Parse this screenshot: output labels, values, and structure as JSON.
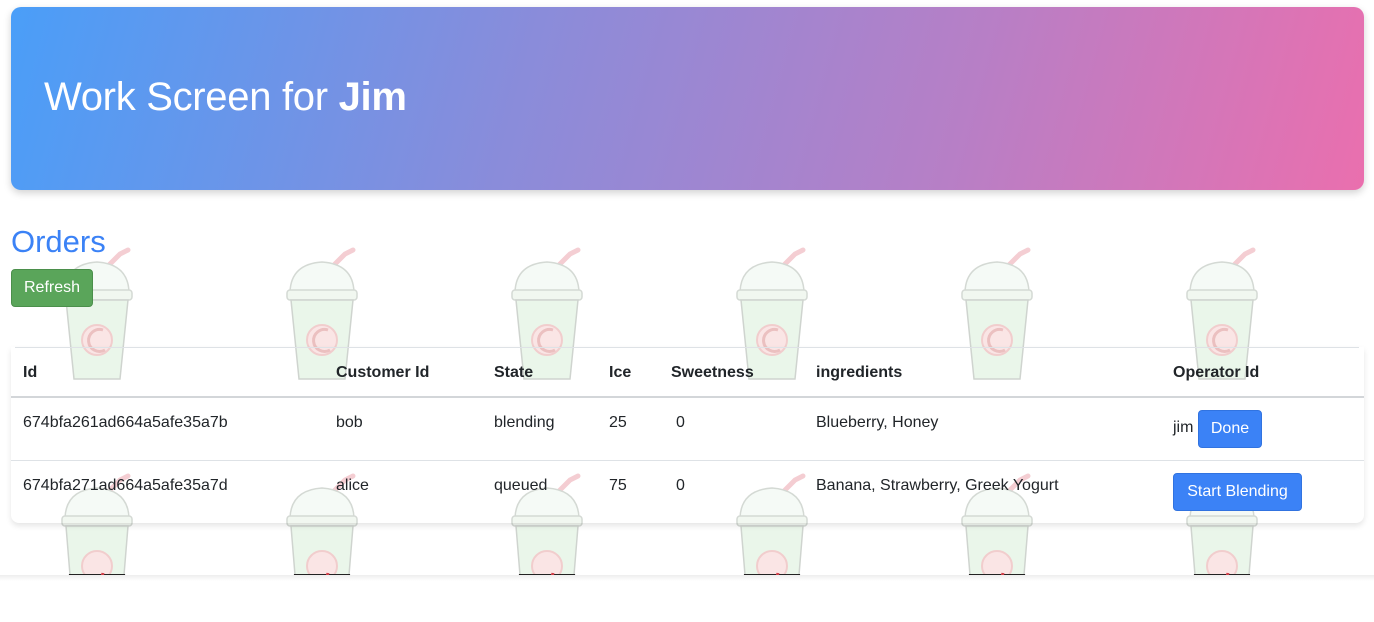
{
  "header": {
    "title_prefix": "Work Screen for",
    "operator_name": "Jim"
  },
  "orders": {
    "title": "Orders",
    "refresh_label": "Refresh",
    "columns": [
      "Id",
      "Customer Id",
      "State",
      "Ice",
      "Sweetness",
      "ingredients",
      "Operator Id"
    ],
    "rows": [
      {
        "id": "674bfa261ad664a5afe35a7b",
        "customer_id": "bob",
        "state": "blending",
        "ice": "25",
        "sweetness": "0",
        "ingredients": "Blueberry, Honey",
        "operator_id": "jim",
        "action_label": "Done"
      },
      {
        "id": "674bfa271ad664a5afe35a7d",
        "customer_id": "alice",
        "state": "queued",
        "ice": "75",
        "sweetness": "0",
        "ingredients": "Banana, Strawberry, Greek Yogurt",
        "operator_id": "",
        "action_label": "Start Blending"
      }
    ]
  },
  "colors": {
    "accent_blue": "#3b82f6",
    "refresh_green": "#5aa55a",
    "header_gradient_start": "#4a9ef8",
    "header_gradient_end": "#ea6fae",
    "cup_green": "#9edc9e"
  },
  "background_icon": "smoothie-cup-icon"
}
